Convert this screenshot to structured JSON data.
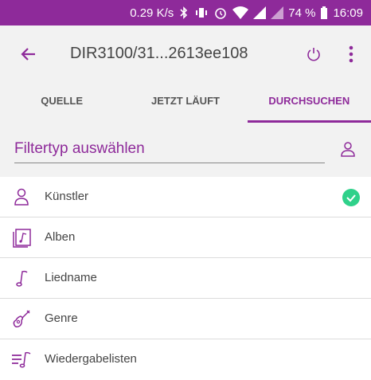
{
  "status_bar": {
    "speed": "0.29 K/s",
    "battery": "74 %",
    "time": "16:09",
    "icons": [
      "bluetooth-icon",
      "vibrate-icon",
      "alarm-icon",
      "wifi-icon",
      "signal-icon",
      "signal-icon-2",
      "battery-icon"
    ]
  },
  "app_bar": {
    "title": "DIR3100/31...2613ee108",
    "back_icon": "back-arrow-icon",
    "power_icon": "power-icon",
    "more_icon": "more-vert-icon"
  },
  "tabs": [
    {
      "label": "QUELLE",
      "active": false
    },
    {
      "label": "JETZT LÄUFT",
      "active": false
    },
    {
      "label": "DURCHSUCHEN",
      "active": true
    }
  ],
  "filter": {
    "label": "Filtertyp auswählen",
    "icon": "person-icon"
  },
  "list": [
    {
      "label": "Künstler",
      "icon": "person-icon",
      "selected": true
    },
    {
      "label": "Alben",
      "icon": "album-icon",
      "selected": false
    },
    {
      "label": "Liedname",
      "icon": "music-note-icon",
      "selected": false
    },
    {
      "label": "Genre",
      "icon": "guitar-icon",
      "selected": false
    },
    {
      "label": "Wiedergabelisten",
      "icon": "playlist-icon",
      "selected": false
    }
  ],
  "colors": {
    "accent": "#8e2a9a",
    "check": "#2fd18a",
    "background": "#f2f2f2"
  }
}
